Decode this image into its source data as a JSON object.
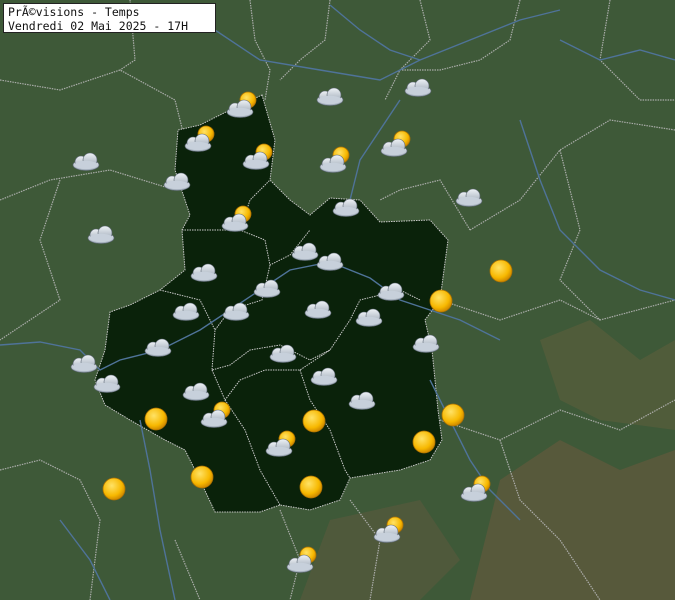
{
  "header": {
    "title": "PrÃ©visions - Temps",
    "subtitle": "Vendredi 02 Mai 2025 - 17H"
  },
  "colors": {
    "background": "#3f5a3a",
    "region_fill": "#0b240b",
    "border": "#b9b9b9",
    "river": "#4b6f95",
    "sun": "#f7b800",
    "cloud": "#c9d2dd"
  },
  "forecast_icons": [
    {
      "icon": "cloud-icon"
    },
    {
      "icon": "sun-cloud-icon"
    },
    {
      "icon": "sun-cloud-icon"
    },
    {
      "icon": "sun-cloud-icon"
    },
    {
      "icon": "cloud-icon"
    },
    {
      "icon": "cloud-icon"
    },
    {
      "icon": "sun-cloud-icon"
    },
    {
      "icon": "sun-cloud-icon"
    },
    {
      "icon": "sun-cloud-icon"
    },
    {
      "icon": "cloud-icon"
    },
    {
      "icon": "cloud-icon"
    },
    {
      "icon": "cloud-icon"
    },
    {
      "icon": "cloud-icon"
    },
    {
      "icon": "cloud-icon"
    },
    {
      "icon": "cloud-icon"
    },
    {
      "icon": "cloud-icon"
    },
    {
      "icon": "cloud-icon"
    },
    {
      "icon": "sun-icon"
    },
    {
      "icon": "cloud-icon"
    },
    {
      "icon": "cloud-icon"
    },
    {
      "icon": "cloud-icon"
    },
    {
      "icon": "sun-icon"
    },
    {
      "icon": "cloud-icon"
    },
    {
      "icon": "cloud-icon"
    },
    {
      "icon": "cloud-icon"
    },
    {
      "icon": "cloud-icon"
    },
    {
      "icon": "cloud-icon"
    },
    {
      "icon": "cloud-icon"
    },
    {
      "icon": "cloud-icon"
    },
    {
      "icon": "cloud-icon"
    },
    {
      "icon": "cloud-icon"
    },
    {
      "icon": "cloud-icon"
    },
    {
      "icon": "sun-icon"
    },
    {
      "icon": "sun-cloud-icon"
    },
    {
      "icon": "sun-icon"
    },
    {
      "icon": "sun-icon"
    },
    {
      "icon": "sun-icon"
    },
    {
      "icon": "sun-icon"
    },
    {
      "icon": "sun-cloud-icon"
    },
    {
      "icon": "sun-icon"
    },
    {
      "icon": "sun-icon"
    },
    {
      "icon": "sun-cloud-icon"
    },
    {
      "icon": "sun-cloud-icon"
    },
    {
      "icon": "sun-cloud-icon"
    }
  ]
}
